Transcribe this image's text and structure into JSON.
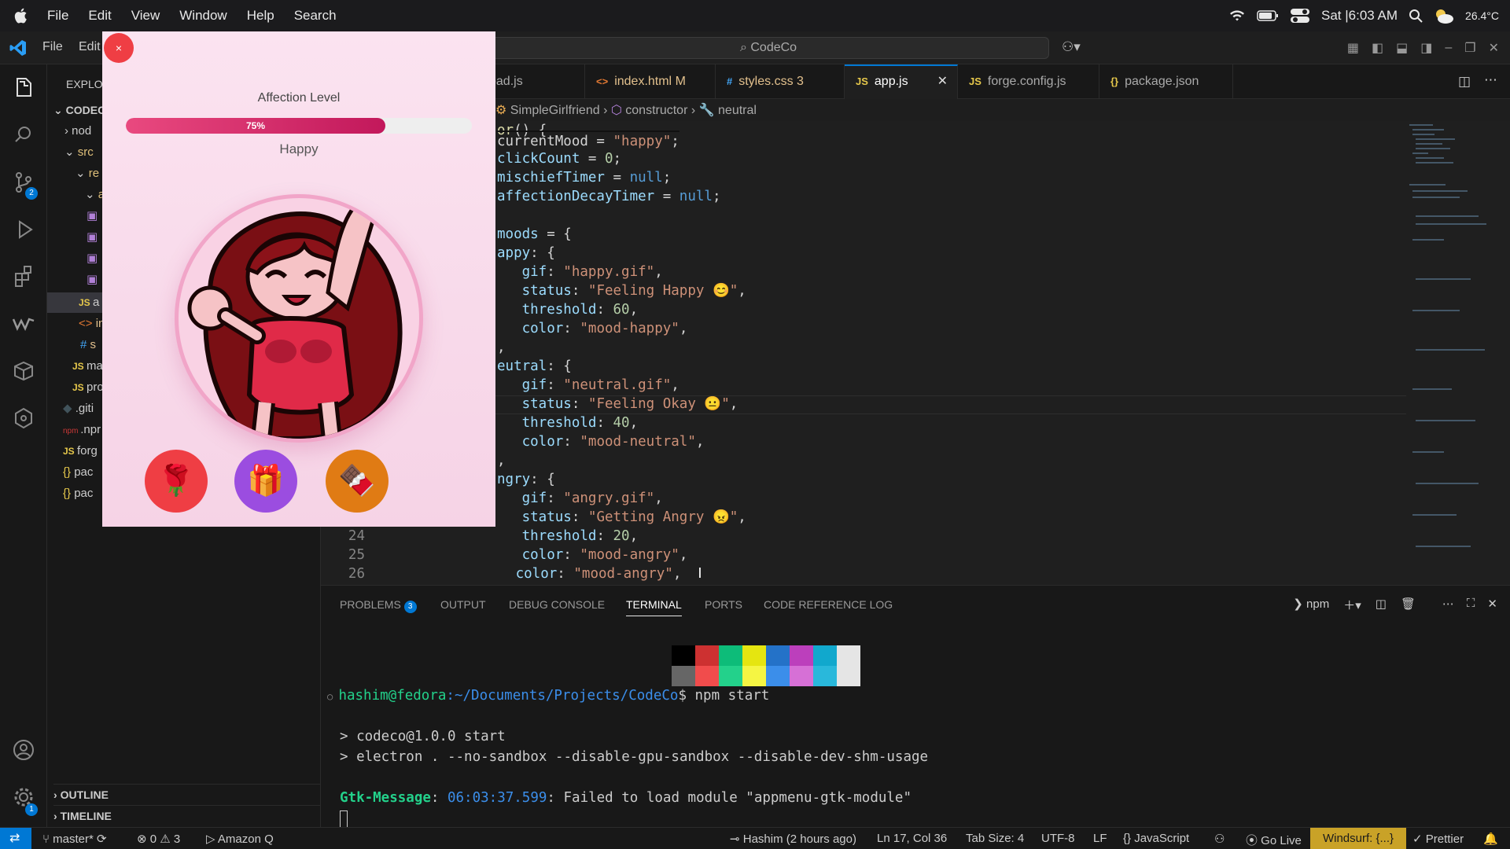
{
  "macbar": {
    "menus": [
      "File",
      "Edit",
      "View",
      "Window",
      "Help",
      "Search"
    ],
    "datetime": "Sat |6:03 AM",
    "temperature": "26.4°C"
  },
  "vscode": {
    "menu_file": "File",
    "menu_edit": "Edit",
    "command_center": "CodeCo",
    "tabs": [
      {
        "icon": "JS",
        "label": "oad.js",
        "suffix": ""
      },
      {
        "icon": "<>",
        "label": "index.html",
        "suffix": "M"
      },
      {
        "icon": "#",
        "label": "styles.css",
        "suffix": "3"
      },
      {
        "icon": "JS",
        "label": "app.js",
        "suffix": ""
      },
      {
        "icon": "JS",
        "label": "forge.config.js",
        "suffix": ""
      },
      {
        "icon": "{}",
        "label": "package.json",
        "suffix": ""
      }
    ],
    "breadcrumb": [
      "SimpleGirlfriend",
      "constructor",
      "neutral"
    ],
    "explorer": {
      "header": "EXPLO",
      "root": "CODEC",
      "items": [
        "nod",
        "src",
        "re",
        "a",
        "a",
        "in",
        "s",
        "ma",
        "pro",
        ".giti",
        ".npr",
        "forg",
        "pac",
        "pac"
      ],
      "outline": "OUTLINE",
      "timeline": "TIMELINE"
    },
    "badges": {
      "scm": "2",
      "settings": "1"
    },
    "line_numbers": [
      "24",
      "25",
      "26"
    ]
  },
  "panel": {
    "tabs": [
      "PROBLEMS",
      "OUTPUT",
      "DEBUG CONSOLE",
      "TERMINAL",
      "PORTS",
      "CODE REFERENCE LOG"
    ],
    "problems_count": "3",
    "terminal_profile": "npm",
    "prompt_user": "hashim@fedora",
    "prompt_path": ":~/Documents/Projects/CodeCo",
    "prompt_cmd": "$ npm start",
    "line1": "> codeco@1.0.0 start",
    "line2": "> electron . --no-sandbox --disable-gpu-sandbox --disable-dev-shm-usage",
    "gtk_label": "Gtk-Message",
    "gtk_time": "06:03:37.599",
    "gtk_msg": ": Failed to load module \"appmenu-gtk-module\""
  },
  "statusbar": {
    "branch": "master*",
    "errors": "0",
    "warnings": "3",
    "amazon_q": "Amazon Q",
    "blame": "Hashim (2 hours ago)",
    "cursor": "Ln 17, Col 36",
    "tab_size": "Tab Size: 4",
    "encoding": "UTF-8",
    "eol": "LF",
    "language": "JavaScript",
    "golive": "Go Live",
    "windsurf": "Windsurf: {...}",
    "prettier": "Prettier"
  },
  "app": {
    "close": "×",
    "affection_label": "Affection Level",
    "affection_percent": "75%",
    "affection_value": 0.75,
    "mood": "Happy",
    "buttons": [
      "🌹",
      "🎁",
      "🍫"
    ]
  },
  "colors": {
    "accent": "#0078d4",
    "windsurf": "#c9a227",
    "affection_fill": "#e9497f",
    "rose": "#ef3e44",
    "gift": "#9b4de0",
    "chocolate": "#e07b14"
  }
}
